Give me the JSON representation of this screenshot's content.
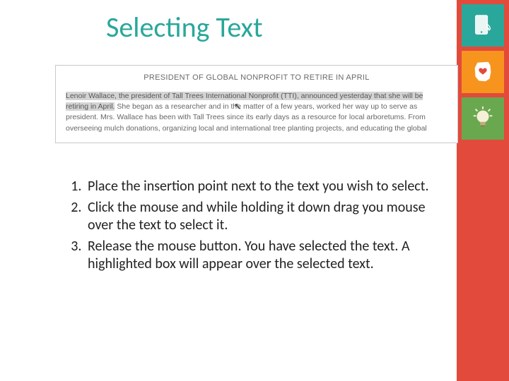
{
  "title": "Selecting Text",
  "rail_icons": {
    "touch": "touch-device-icon",
    "ohio": "ohio-heart-icon",
    "bulb": "lightbulb-icon"
  },
  "doc": {
    "headline": "PRESIDENT OF GLOBAL NONPROFIT TO RETIRE IN APRIL",
    "highlighted": "Lenoir Wallace, the president of Tall Trees International Nonprofit (TTI), announced yesterday that she will be retiring in April.",
    "rest": " She began as a researcher and in the matter of a few years, worked her way up to serve as president. Mrs. Wallace has been with Tall Trees since its early days as a resource for local arboretums. From overseeing mulch donations, organizing local and international tree planting projects, and educating the global"
  },
  "steps": {
    "s1": "Place the insertion point next to the text you wish to select.",
    "s2": "Click the mouse and while holding it down drag you mouse over the text to select it.",
    "s3": "Release the mouse button.  You have selected the text. A highlighted box will appear over the selected text."
  }
}
